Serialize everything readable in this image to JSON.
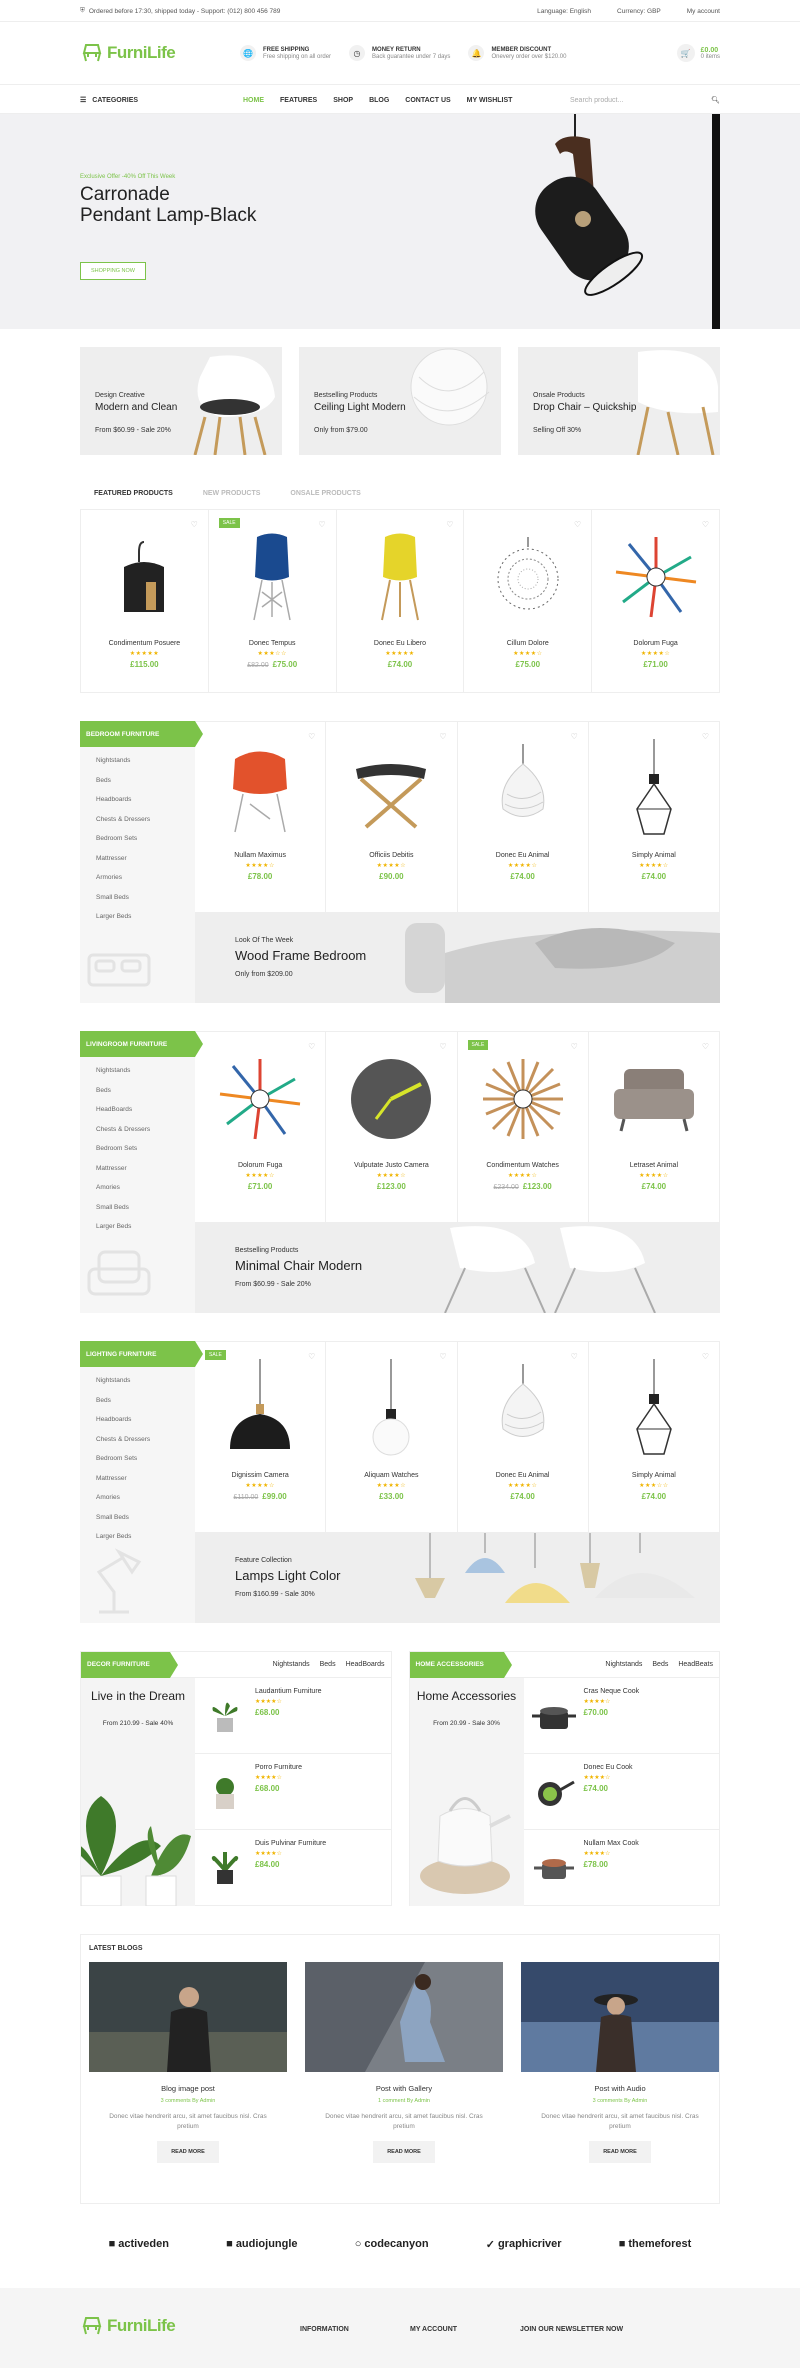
{
  "topbar": {
    "notice": "Ordered before 17:30, shipped today - Support: (012) 800 456 789",
    "language": "Language:  English",
    "currency": "Currency:  GBP",
    "account": "My account"
  },
  "header": {
    "logo": "FurniLife",
    "features": [
      {
        "title": "FREE SHIPPING",
        "sub": "Free shipping on all order",
        "icon": "globe-icon"
      },
      {
        "title": "MONEY RETURN",
        "sub": "Back guarantee under 7 days",
        "icon": "clock-icon"
      },
      {
        "title": "MEMBER DISCOUNT",
        "sub": "Onevery order over $120.00",
        "icon": "bell-icon"
      }
    ],
    "cart_price": "£0.00",
    "cart_items": "0 items"
  },
  "nav": {
    "categories": "CATEGORIES",
    "menu": [
      "HOME",
      "FEATURES",
      "SHOP",
      "BLOG",
      "CONTACT US",
      "MY WISHLIST"
    ],
    "search_placeholder": "Search product..."
  },
  "hero": {
    "small": "Exclusive Offer -40% Off This Week",
    "line1": "Carronade",
    "line2": "Pendant Lamp-Black",
    "button": "SHOPPING NOW"
  },
  "banners": [
    {
      "t1": "Design Creative",
      "t2": "Modern and Clean",
      "t3": "From  $60.99 - Sale 20%"
    },
    {
      "t1": "Bestselling Products",
      "t2": "Ceiling Light Modern",
      "t3": "Only  from  $79.00"
    },
    {
      "t1": "Onsale Products",
      "t2": "Drop Chair – Quickship",
      "t3": "Selling Off  30%"
    }
  ],
  "tabs": [
    "FEATURED PRODUCTS",
    "NEW PRODUCTS",
    "ONSALE PRODUCTS"
  ],
  "featured": [
    {
      "name": "Condimentum Posuere",
      "stars": "★★★★★",
      "price": "£115.00",
      "old": ""
    },
    {
      "name": "Donec Tempus",
      "stars": "★★★☆☆",
      "price": "£75.00",
      "old": "£82.00",
      "sale": "SALE"
    },
    {
      "name": "Donec Eu Libero",
      "stars": "★★★★★",
      "price": "£74.00",
      "old": ""
    },
    {
      "name": "Cillum Dolore",
      "stars": "★★★★☆",
      "price": "£75.00",
      "old": ""
    },
    {
      "name": "Dolorum Fuga",
      "stars": "★★★★☆",
      "price": "£71.00",
      "old": ""
    }
  ],
  "categories": [
    {
      "label": "BEDROOM FURNITURE",
      "items": [
        "Nightstands",
        "Beds",
        "Headboards",
        "Chests & Dressers",
        "Bedroom Sets",
        "Mattresser",
        "Armories",
        "Small Beds",
        "Larger Beds"
      ],
      "products": [
        {
          "name": "Nullam Maximus",
          "stars": "★★★★☆",
          "price": "£78.00",
          "old": ""
        },
        {
          "name": "Officiis Debitis",
          "stars": "★★★★☆",
          "price": "£90.00",
          "old": ""
        },
        {
          "name": "Donec Eu Animal",
          "stars": "★★★★☆",
          "price": "£74.00",
          "old": ""
        },
        {
          "name": "Simply Animal",
          "stars": "★★★★☆",
          "price": "£74.00",
          "old": ""
        }
      ],
      "banner": {
        "t1": "Look Of The Week",
        "t2": "Wood Frame Bedroom",
        "t3": "Only  from  $209.00"
      }
    },
    {
      "label": "LIVINGROOM FURNITURE",
      "items": [
        "Nightstands",
        "Beds",
        "HeadBoards",
        "Chests & Dressers",
        "Bedroom Sets",
        "Mattresser",
        "Amories",
        "Small Beds",
        "Larger Beds"
      ],
      "products": [
        {
          "name": "Dolorum Fuga",
          "stars": "★★★★☆",
          "price": "£71.00",
          "old": ""
        },
        {
          "name": "Vulputate Justo Camera",
          "stars": "★★★★☆",
          "price": "£123.00",
          "old": ""
        },
        {
          "name": "Condimentum Watches",
          "stars": "★★★★☆",
          "price": "£123.00",
          "old": "£234.00",
          "sale": "SALE"
        },
        {
          "name": "Letraset Animal",
          "stars": "★★★★☆",
          "price": "£74.00",
          "old": ""
        }
      ],
      "banner": {
        "t1": "Bestselling Products",
        "t2": "Minimal Chair Modern",
        "t3": "From  $60.99 - Sale 20%"
      }
    },
    {
      "label": "LIGHTING FURNITURE",
      "items": [
        "Nightstands",
        "Beds",
        "Headboards",
        "Chests & Dressers",
        "Bedroom Sets",
        "Mattresser",
        "Amories",
        "Small Beds",
        "Larger Beds"
      ],
      "products": [
        {
          "name": "Dignissim Camera",
          "stars": "★★★★☆",
          "price": "£99.00",
          "old": "£110.00",
          "sale": "SALE"
        },
        {
          "name": "Aliquam Watches",
          "stars": "★★★★☆",
          "price": "£33.00",
          "old": ""
        },
        {
          "name": "Donec Eu Animal",
          "stars": "★★★★☆",
          "price": "£74.00",
          "old": ""
        },
        {
          "name": "Simply Animal",
          "stars": "★★★☆☆",
          "price": "£74.00",
          "old": ""
        }
      ],
      "banner": {
        "t1": "Feature Collection",
        "t2": "Lamps Light Color",
        "t3": "From  $160.99 - Sale 30%"
      }
    }
  ],
  "decor": {
    "label": "DECOR FURNITURE",
    "links": [
      "Nightstands",
      "Beds",
      "HeadBoards"
    ],
    "banner_t1": "Live in the Dream",
    "banner_t2": "From  210.99 - Sale 40%",
    "items": [
      {
        "name": "Laudantium Furniture",
        "stars": "★★★★☆",
        "price": "£68.00"
      },
      {
        "name": "Porro Furniture",
        "stars": "★★★★☆",
        "price": "£68.00"
      },
      {
        "name": "Duis Pulvinar Furniture",
        "stars": "★★★★☆",
        "price": "£84.00"
      }
    ]
  },
  "home": {
    "label": "HOME ACCESSORIES",
    "links": [
      "Nightstands",
      "Beds",
      "HeadBeats"
    ],
    "banner_t1": "Home Accessories",
    "banner_t2": "From  20.99 - Sale 30%",
    "items": [
      {
        "name": "Cras Neque Cook",
        "stars": "★★★★☆",
        "price": "£70.00"
      },
      {
        "name": "Donec Eu Cook",
        "stars": "★★★★☆",
        "price": "£74.00"
      },
      {
        "name": "Nullam Max Cook",
        "stars": "★★★★☆",
        "price": "£78.00"
      }
    ]
  },
  "blogs": {
    "title": "LATEST BLOGS",
    "posts": [
      {
        "name": "Blog image post",
        "meta": "3 comments   By Admin",
        "desc": "Donec vitae hendrerit arcu, sit amet faucibus nisl. Cras pretium",
        "more": "READ MORE"
      },
      {
        "name": "Post with Gallery",
        "meta": "1 comment   By Admin",
        "desc": "Donec vitae hendrerit arcu, sit amet faucibus nisl. Cras pretium",
        "more": "READ MORE"
      },
      {
        "name": "Post with Audio",
        "meta": "3 comments   By Admin",
        "desc": "Donec vitae hendrerit arcu, sit amet faucibus nisl. Cras pretium",
        "more": "READ MORE"
      }
    ]
  },
  "brands": [
    "activeden",
    "audiojungle",
    "codecanyon",
    "graphicriver",
    "themeforest"
  ],
  "footer": {
    "logo": "FurniLife",
    "cols": [
      "INFORMATION",
      "MY ACCOUNT",
      "JOIN OUR NEWSLETTER NOW"
    ]
  },
  "colors": {
    "accent": "#7cc349",
    "star": "#f0b400",
    "banner_bg": "#eeeeee"
  }
}
